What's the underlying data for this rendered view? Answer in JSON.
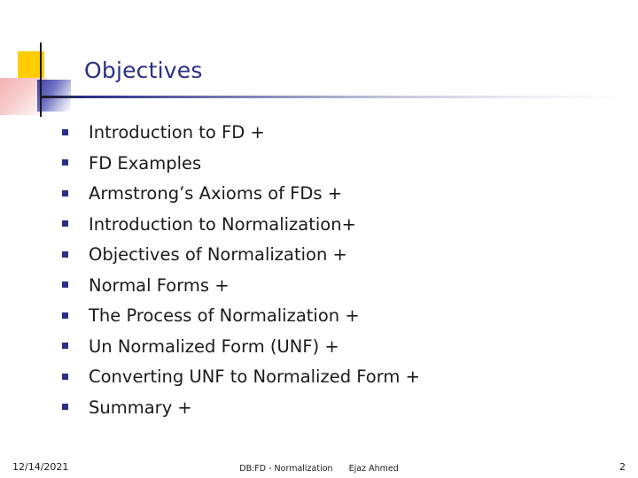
{
  "slide": {
    "title": "Objectives",
    "accent_color": "#2b2f86",
    "bullets": [
      {
        "marker": "square-bullet",
        "text": "Introduction to FD +"
      },
      {
        "marker": "square-bullet",
        "text": "FD Examples"
      },
      {
        "marker": "square-bullet",
        "text": "Armstrong’s Axioms of FDs +"
      },
      {
        "marker": "square-bullet",
        "text": "Introduction to Normalization+"
      },
      {
        "marker": "square-bullet",
        "text": "Objectives of Normalization +"
      },
      {
        "marker": "square-bullet",
        "text": "Normal Forms +"
      },
      {
        "marker": "square-bullet",
        "text": "The Process of Normalization +"
      },
      {
        "marker": "square-bullet",
        "text": "Un Normalized Form (UNF) +"
      },
      {
        "marker": "square-bullet",
        "text": "Converting UNF to Normalized Form +"
      },
      {
        "marker": "square-bullet",
        "text": "Summary +"
      }
    ]
  },
  "footer": {
    "date": "12/14/2021",
    "subject": "DB:FD - Normalization",
    "author": "Ejaz Ahmed",
    "page_number": "2"
  }
}
